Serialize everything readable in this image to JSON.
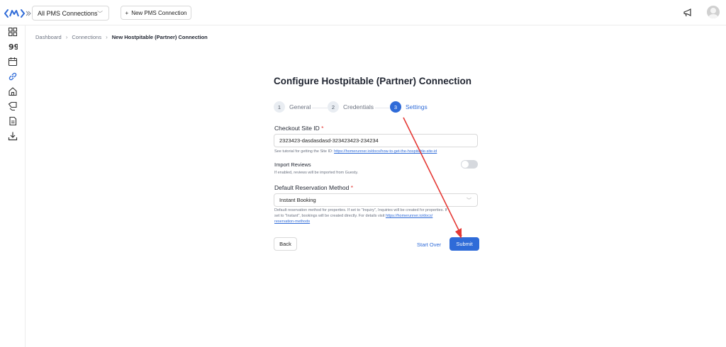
{
  "topbar": {
    "pms_select_value": "All PMS Connections",
    "new_connection_label": "New PMS Connection"
  },
  "breadcrumb": {
    "items": [
      "Dashboard",
      "Connections",
      "New Hostpitable (Partner) Connection"
    ]
  },
  "page": {
    "title": "Configure Hostpitable (Partner) Connection"
  },
  "steps": [
    {
      "num": "1",
      "label": "General"
    },
    {
      "num": "2",
      "label": "Credentials"
    },
    {
      "num": "3",
      "label": "Settings"
    }
  ],
  "active_step": 3,
  "form": {
    "site_id_label": "Checkout Site ID",
    "required_mark": "*",
    "site_id_value": "2323423-dasdasdasd-323423423-234234",
    "site_id_help_prefix": "See tutorial for getting the Site ID: ",
    "site_id_help_link": "https://homerunner.io/docs/how-to-get-the-hospitable-site-id",
    "import_reviews_label": "Import Reviews",
    "import_reviews_help": "If enabled, reviews will be imported from Guesty.",
    "import_reviews_on": false,
    "reservation_method_label": "Default Reservation Method",
    "reservation_method_value": "Instant Booking",
    "reservation_help_line1": "Default reservation method for properties. If set to \"Inquiry\", Inquiries will be created for properties. If",
    "reservation_help_line2": "set to \"Instant\", bookings will be created directly. For details visit ",
    "reservation_help_link1": "https://homerunner.io/docs/",
    "reservation_help_link2": "reservation-methods"
  },
  "actions": {
    "back_label": "Back",
    "start_over_label": "Start Over",
    "submit_label": "Submit"
  },
  "colors": {
    "accent": "#2f6bd8",
    "annotation_arrow": "#e53935"
  },
  "icons": {
    "brand": "logo-icon",
    "expand": "double-chevron-right-icon",
    "megaphone": "megaphone-icon",
    "sidebar": [
      "dashboard-icon",
      "reviews-icon",
      "calendar-icon",
      "connections-icon",
      "home-icon",
      "tags-icon",
      "document-icon",
      "download-icon"
    ]
  }
}
